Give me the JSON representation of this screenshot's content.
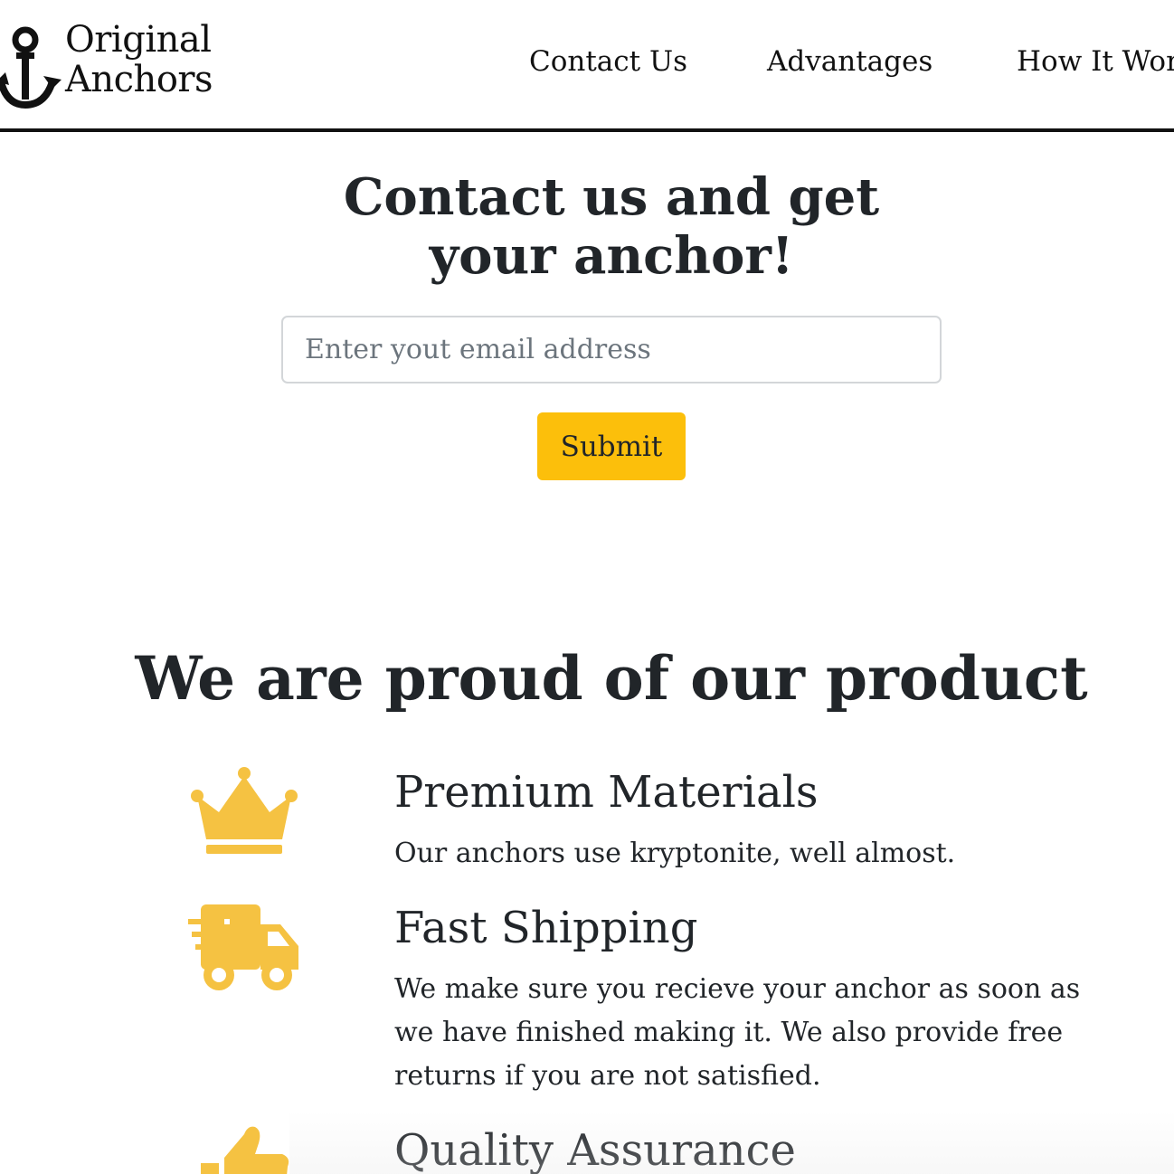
{
  "header": {
    "logo": {
      "line1": "Original",
      "line2": "Anchors",
      "icon": "anchor-icon"
    },
    "nav": [
      {
        "label": "Contact Us"
      },
      {
        "label": "Advantages"
      },
      {
        "label": "How It Wor"
      }
    ]
  },
  "contact": {
    "title": "Contact us and get your anchor!",
    "email_placeholder": "Enter yout email address",
    "submit_label": "Submit"
  },
  "features": {
    "title": "We are proud of our product",
    "items": [
      {
        "icon": "crown-icon",
        "heading": "Premium Materials",
        "text": "Our anchors use kryptonite, well almost."
      },
      {
        "icon": "shipping-truck-icon",
        "heading": "Fast Shipping",
        "text": "We make sure you recieve your anchor as soon as we have finished making it. We also provide free returns if you are not satisfied."
      },
      {
        "icon": "thumbs-up-icon",
        "heading": "Quality Assurance",
        "text": ""
      }
    ]
  },
  "colors": {
    "accent": "#fcbf0b",
    "icon": "#f5c242",
    "text": "#212529",
    "border": "#111111"
  }
}
